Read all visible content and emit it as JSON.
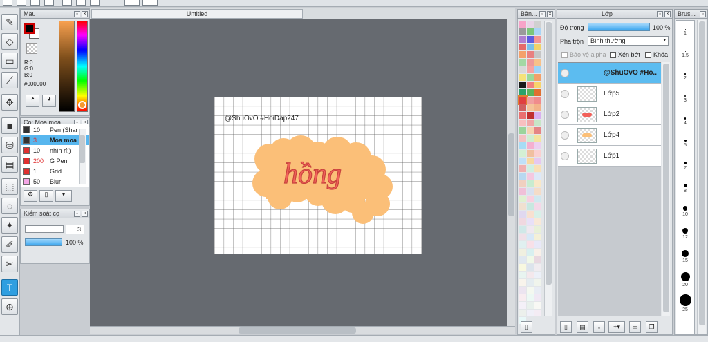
{
  "document": {
    "tab_title": "Untitled",
    "watermark": "@ShuOvO #HoiDap247",
    "hand_text": "hồng"
  },
  "color_panel": {
    "title": "Màu",
    "r": "R:0",
    "g": "G:0",
    "b": "B:0",
    "hex": "#000000"
  },
  "brush_panel": {
    "title": "Cọ: Moa moa",
    "rows": [
      {
        "size": "10",
        "name": "Pen (Shar",
        "color": "#333333"
      },
      {
        "size": "3",
        "name": "Moa moa",
        "color": "#333333"
      },
      {
        "size": "10",
        "name": "nhìn rỉ:)",
        "color": "#e03030"
      },
      {
        "size": "200",
        "name": "G Pen",
        "color": "#e03030"
      },
      {
        "size": "1",
        "name": "Grid",
        "color": "#e03030"
      },
      {
        "size": "50",
        "name": "Blur",
        "color": "#f4a6e6"
      }
    ]
  },
  "brush_control": {
    "title": "Kiểm soát cọ",
    "size_value": "3",
    "opacity_label": "100 %"
  },
  "swatch_panel": {
    "title": "Bản..."
  },
  "layer_panel": {
    "title": "Lớp",
    "opacity_label": "Độ trong",
    "opacity_value": "100 %",
    "blend_label": "Pha trộn",
    "blend_value": "Bình thường",
    "protect_alpha": "Bảo vệ alpha",
    "clipping": "Xén bớt",
    "lock": "Khóa",
    "layers": [
      {
        "name": "@ShuOvO #Ho..",
        "selected": true
      },
      {
        "name": "Lớp5",
        "selected": false
      },
      {
        "name": "Lớp2",
        "selected": false
      },
      {
        "name": "Lớp4",
        "selected": false
      },
      {
        "name": "Lớp1",
        "selected": false
      }
    ]
  },
  "brush_size_panel": {
    "title": "Brus...",
    "sizes": [
      "1",
      "1.5",
      "2",
      "3",
      "4",
      "5",
      "7",
      "8",
      "10",
      "12",
      "15",
      "20",
      "25"
    ]
  },
  "colors": {
    "accent": "#2e9ee0",
    "canvas_bg": "#666a70",
    "blob": "#fbbf78",
    "lettering": "#f2615a"
  }
}
